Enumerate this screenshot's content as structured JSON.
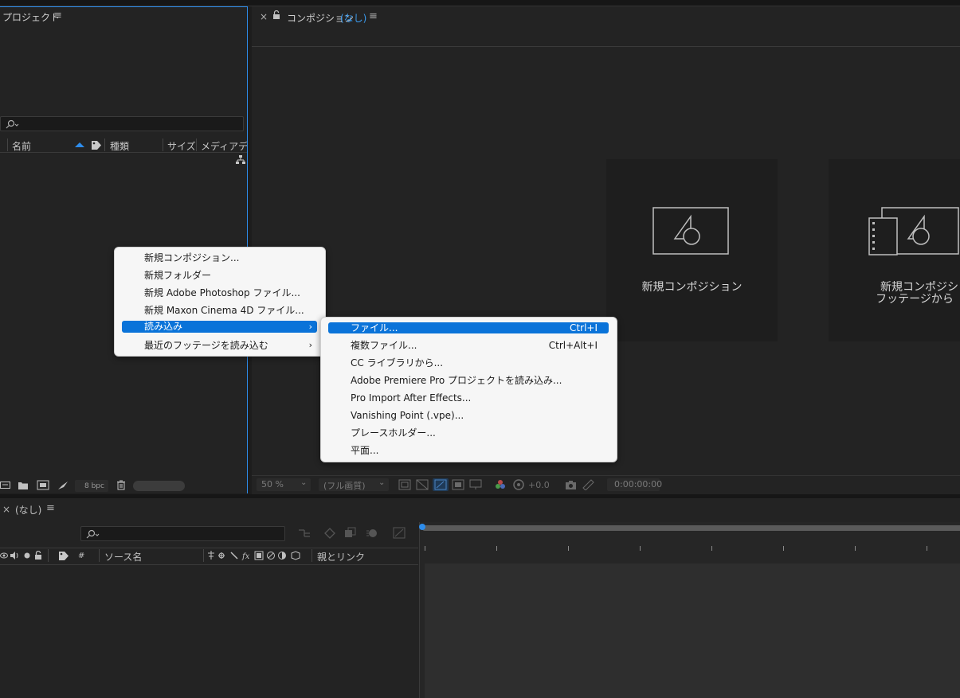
{
  "project_panel": {
    "title": "プロジェクト",
    "search_icon": "search-icon",
    "columns": [
      "名前",
      "種類",
      "サイズ",
      "メディアデュ"
    ],
    "bpc_label": "8 bpc"
  },
  "composition_panel": {
    "close": "×",
    "title": "コンポジション",
    "title_suffix": "(なし)",
    "tiles": [
      {
        "label": "新規コンポジション"
      },
      {
        "label": "新規コンポジション",
        "label2": "フッテージから"
      }
    ],
    "toolbar": {
      "zoom": "50 %",
      "resolution": "(フル画質)",
      "exposure": "+0.0",
      "timecode": "0:00:00:00"
    }
  },
  "timeline_panel": {
    "close": "×",
    "title": "(なし)",
    "columns": {
      "number": "#",
      "source_name": "ソース名",
      "parent_link": "親とリンク"
    }
  },
  "context_menu": {
    "items": [
      {
        "label": "新規コンポジション..."
      },
      {
        "label": "新規フォルダー"
      },
      {
        "label": "新規 Adobe Photoshop ファイル..."
      },
      {
        "label": "新規 Maxon Cinema 4D ファイル..."
      },
      {
        "label": "読み込み",
        "submenu": true,
        "selected": true
      },
      {
        "label": "最近のフッテージを読み込む",
        "submenu": true
      }
    ]
  },
  "import_submenu": {
    "items": [
      {
        "label": "ファイル...",
        "shortcut": "Ctrl+I",
        "selected": true
      },
      {
        "label": "複数ファイル...",
        "shortcut": "Ctrl+Alt+I"
      },
      {
        "label": "CC ライブラリから..."
      },
      {
        "label": "Adobe Premiere Pro プロジェクトを読み込み..."
      },
      {
        "label": "Pro Import After Effects..."
      },
      {
        "label": "Vanishing Point (.vpe)..."
      },
      {
        "label": "プレースホルダー..."
      },
      {
        "label": "平面..."
      }
    ]
  }
}
